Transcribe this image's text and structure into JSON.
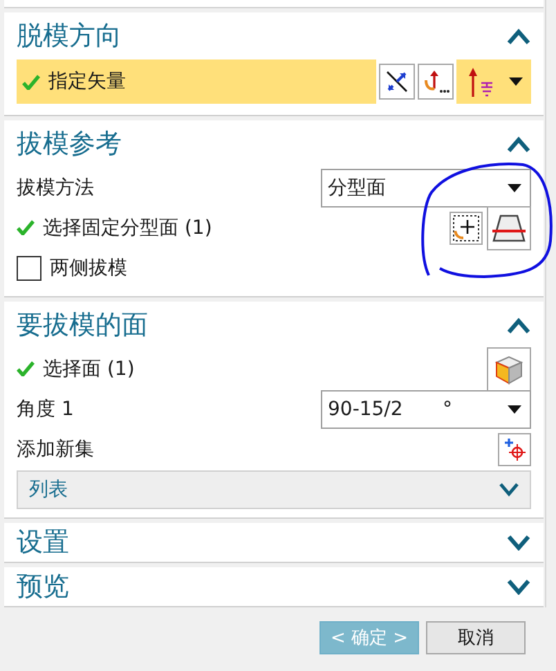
{
  "sections": [
    {
      "title": "脱模方向",
      "expanded": true,
      "rows": [
        {
          "kind": "vector",
          "label": "指定矢量",
          "done": true,
          "highlighted": true
        }
      ]
    },
    {
      "title": "拔模参考",
      "expanded": true,
      "rows": [
        {
          "kind": "dropdown",
          "label": "拔模方法",
          "value": "分型面"
        },
        {
          "kind": "plane-select",
          "label": "选择固定分型面 (1)",
          "done": true,
          "annotated": true
        },
        {
          "kind": "checkbox",
          "label": "两侧拔模",
          "checked": false
        }
      ]
    },
    {
      "title": "要拔模的面",
      "expanded": true,
      "rows": [
        {
          "kind": "face-select",
          "label": "选择面 (1)",
          "done": true
        },
        {
          "kind": "expression",
          "label": "角度 1",
          "value": "90-15/2",
          "unit": "°"
        },
        {
          "kind": "add",
          "label": "添加新集"
        },
        {
          "kind": "list",
          "label": "列表",
          "expanded": false
        }
      ]
    },
    {
      "title": "设置",
      "expanded": false
    },
    {
      "title": "预览",
      "expanded": false
    }
  ],
  "buttons": [
    {
      "label": "< 确定 >",
      "default": true
    },
    {
      "label": "取消",
      "default": false
    }
  ]
}
